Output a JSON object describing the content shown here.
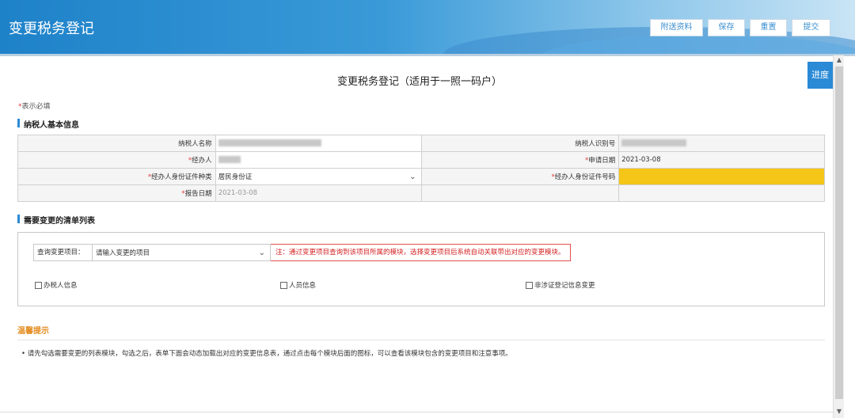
{
  "header": {
    "title": "变更税务登记",
    "buttons": {
      "attach": "附送资料",
      "save": "保存",
      "reset": "重置",
      "submit": "提交"
    }
  },
  "side": {
    "progress": "进度"
  },
  "page_title": "变更税务登记（适用于一照一码户）",
  "required_note": {
    "star": "*",
    "text": "表示必填"
  },
  "section_basic": "纳税人基本信息",
  "basic": {
    "taxpayer_name_label": "纳税人名称",
    "taxpayer_id_label": "纳税人识别号",
    "agent_label": "经办人",
    "apply_date_label": "申请日期",
    "apply_date_value": "2021-03-08",
    "id_type_label": "经办人身份证件种类",
    "id_type_value": "居民身份证",
    "id_no_label": "经办人身份证件号码",
    "report_date_label": "报告日期",
    "report_date_value": "2021-03-08",
    "required_star": "*"
  },
  "section_list": "需要变更的清单列表",
  "query": {
    "label": "查询变更项目：",
    "placeholder": "请输入变更的项目",
    "note": "注：通过变更项目查询到该项目所属的模块，选择变更项目后系统自动关联带出对应的变更模块。"
  },
  "checkboxes": [
    "办税人信息",
    "人员信息",
    "非涉证登记信息变更"
  ],
  "tips": {
    "title": "温馨提示",
    "text": "• 请先勾选需要变更的列表模块，勾选之后，表单下面会动态加载出对应的变更信息表，通过点击每个模块后面的图标，可以查看该模块包含的变更项目和注意事项。"
  },
  "colors": {
    "header_blue": "#1e82c9",
    "accent_blue": "#2b8ad6",
    "required_red": "#e03a3a",
    "highlight_yellow": "#f5c518",
    "tip_orange": "#e38a1c"
  }
}
